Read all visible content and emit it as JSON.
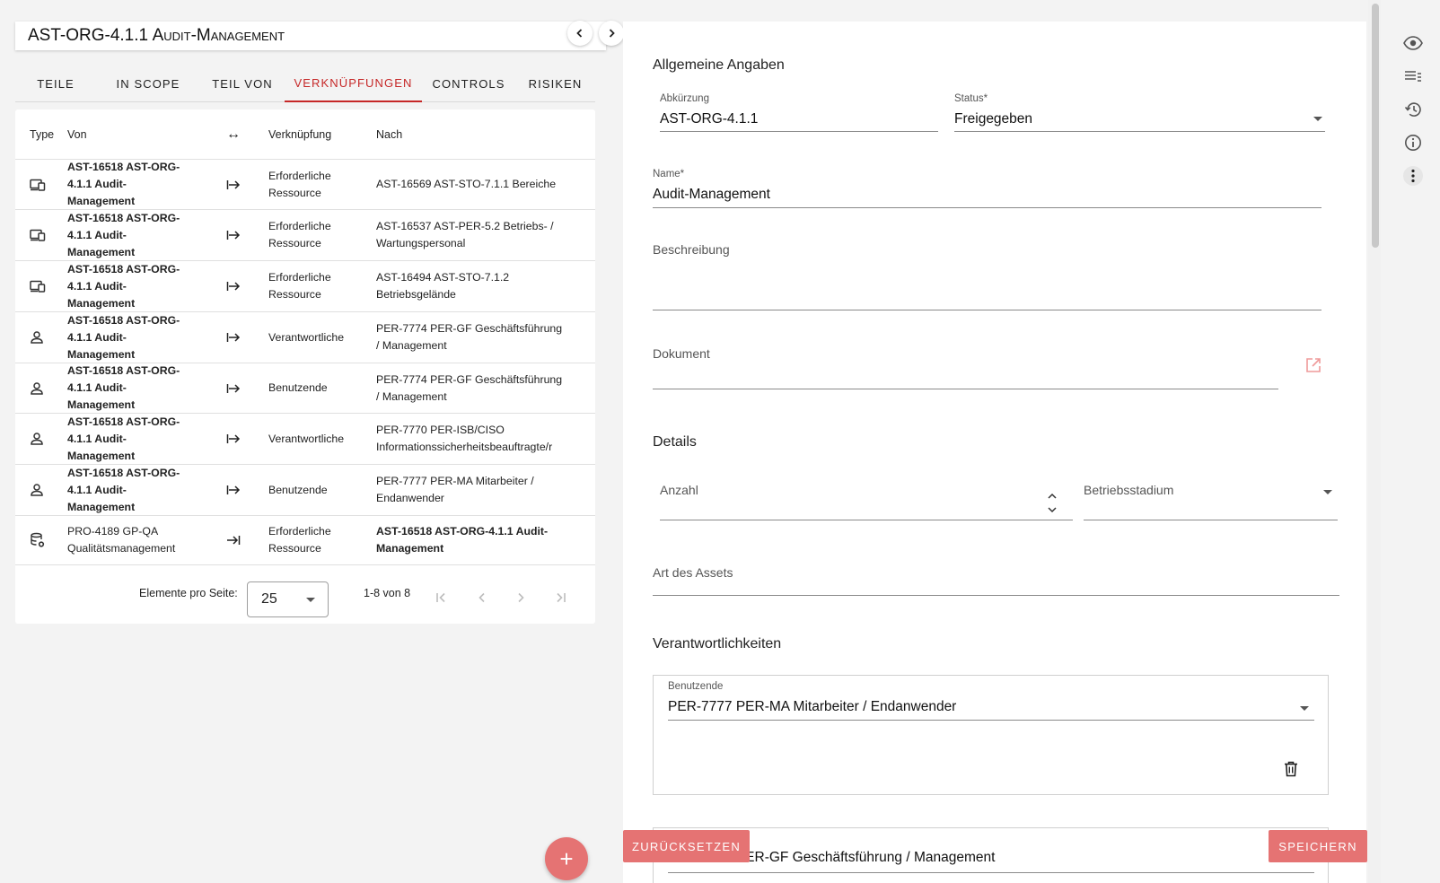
{
  "header": {
    "title_prefix": "AST-ORG-4.1.1",
    "title_rest": "Audit-Management"
  },
  "tabs": [
    {
      "label": "Teile"
    },
    {
      "label": "In Scope"
    },
    {
      "label": "Teil von"
    },
    {
      "label": "Verknüpfungen"
    },
    {
      "label": "Controls"
    },
    {
      "label": "Risiken"
    }
  ],
  "table": {
    "headers": {
      "type": "Type",
      "von": "Von",
      "arrow": "↔",
      "verknuepfung": "Verknüpfung",
      "nach": "Nach"
    },
    "rows": [
      {
        "icon": "devices-icon",
        "von1": "AST-16518 AST-ORG-",
        "von2": "4.1.1 Audit-",
        "von3": "Management",
        "verk1": "Erforderliche",
        "verk2": "Ressource",
        "nach1": "AST-16569 AST-STO-7.1.1 Bereiche",
        "nach2": ""
      },
      {
        "icon": "devices-icon",
        "von1": "AST-16518 AST-ORG-",
        "von2": "4.1.1 Audit-",
        "von3": "Management",
        "verk1": "Erforderliche",
        "verk2": "Ressource",
        "nach1": "AST-16537 AST-PER-5.2 Betriebs- /",
        "nach2": "Wartungspersonal"
      },
      {
        "icon": "devices-icon",
        "von1": "AST-16518 AST-ORG-",
        "von2": "4.1.1 Audit-",
        "von3": "Management",
        "verk1": "Erforderliche",
        "verk2": "Ressource",
        "nach1": "AST-16494 AST-STO-7.1.2",
        "nach2": "Betriebsgelände"
      },
      {
        "icon": "person-icon",
        "von1": "AST-16518 AST-ORG-",
        "von2": "4.1.1 Audit-",
        "von3": "Management",
        "verk1": "Verantwortliche",
        "verk2": "",
        "nach1": "PER-7774 PER-GF Geschäftsführung",
        "nach2": "/ Management"
      },
      {
        "icon": "person-icon",
        "von1": "AST-16518 AST-ORG-",
        "von2": "4.1.1 Audit-",
        "von3": "Management",
        "verk1": "Benutzende",
        "verk2": "",
        "nach1": "PER-7774 PER-GF Geschäftsführung",
        "nach2": "/ Management"
      },
      {
        "icon": "person-icon",
        "von1": "AST-16518 AST-ORG-",
        "von2": "4.1.1 Audit-",
        "von3": "Management",
        "verk1": "Verantwortliche",
        "verk2": "",
        "nach1": "PER-7770 PER-ISB/CISO",
        "nach2": "Informationssicherheitsbeauftragte/r"
      },
      {
        "icon": "person-icon",
        "von1": "AST-16518 AST-ORG-",
        "von2": "4.1.1 Audit-",
        "von3": "Management",
        "verk1": "Benutzende",
        "verk2": "",
        "nach1": "PER-7777 PER-MA Mitarbeiter /",
        "nach2": "Endanwender"
      }
    ],
    "last_row": {
      "icon": "database-settings-icon",
      "von1": "PRO-4189 GP-QA",
      "von2": "Qualitätsmanagement",
      "verk1": "Erforderliche",
      "verk2": "Ressource",
      "nach1": "AST-16518 AST-ORG-4.1.1 Audit-",
      "nach2": "Management"
    }
  },
  "paginator": {
    "label": "Elemente pro Seite:",
    "page_size": "25",
    "range": "1-8 von 8"
  },
  "fab": {
    "label": "+"
  },
  "form": {
    "section_general": "Allgemeine Angaben",
    "abk_label": "Abkürzung",
    "abk_value": "AST-ORG-4.1.1",
    "status_label": "Status*",
    "status_value": "Freigegeben",
    "name_label": "Name*",
    "name_value": "Audit-Management",
    "beschreibung_label": "Beschreibung",
    "dokument_label": "Dokument",
    "section_details": "Details",
    "anzahl_label": "Anzahl",
    "betriebsstadium_label": "Betriebsstadium",
    "art_label": "Art des Assets",
    "section_resp": "Verantwortlichkeiten",
    "resp1_label": "Benutzende",
    "resp1_value": "PER-7777 PER-MA Mitarbeiter / Endanwender",
    "resp2_value": "PER-7774 PER-GF Geschäftsführung / Management"
  },
  "actions": {
    "reset": "Zurücksetzen",
    "save": "Speichern"
  },
  "colors": {
    "accent": "#c62828",
    "button": "#e57373"
  }
}
